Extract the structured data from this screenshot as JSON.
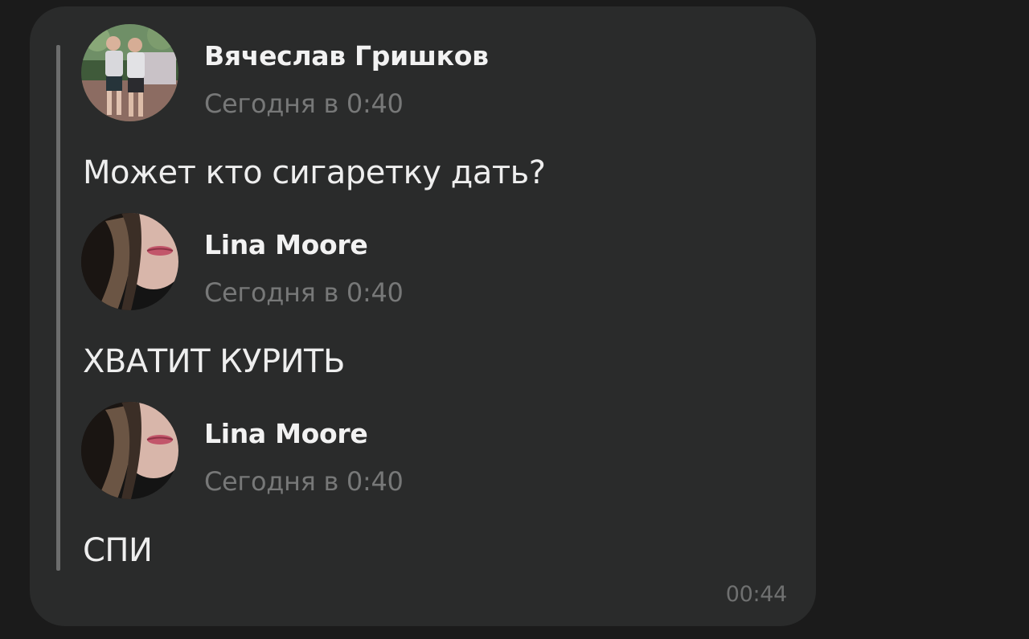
{
  "forwarded": [
    {
      "author": "Вячеслав Гришков",
      "time": "Сегодня в 0:40",
      "text": "Может кто сигаретку дать?",
      "avatar": "avatar-two-boys-photo"
    },
    {
      "author": "Lina Moore",
      "time": "Сегодня в 0:40",
      "text": "ХВАТИТ КУРИТЬ",
      "avatar": "avatar-girl-lips-photo"
    },
    {
      "author": "Lina Moore",
      "time": "Сегодня в 0:40",
      "text": "СПИ",
      "avatar": "avatar-girl-lips-photo"
    }
  ],
  "message_time": "00:44",
  "colors": {
    "page_background": "#1b1b1b",
    "bubble_background": "#2a2b2b",
    "quote_bar": "#6c6d6d",
    "author_text": "#f2f2f2",
    "secondary_text": "#777878"
  }
}
